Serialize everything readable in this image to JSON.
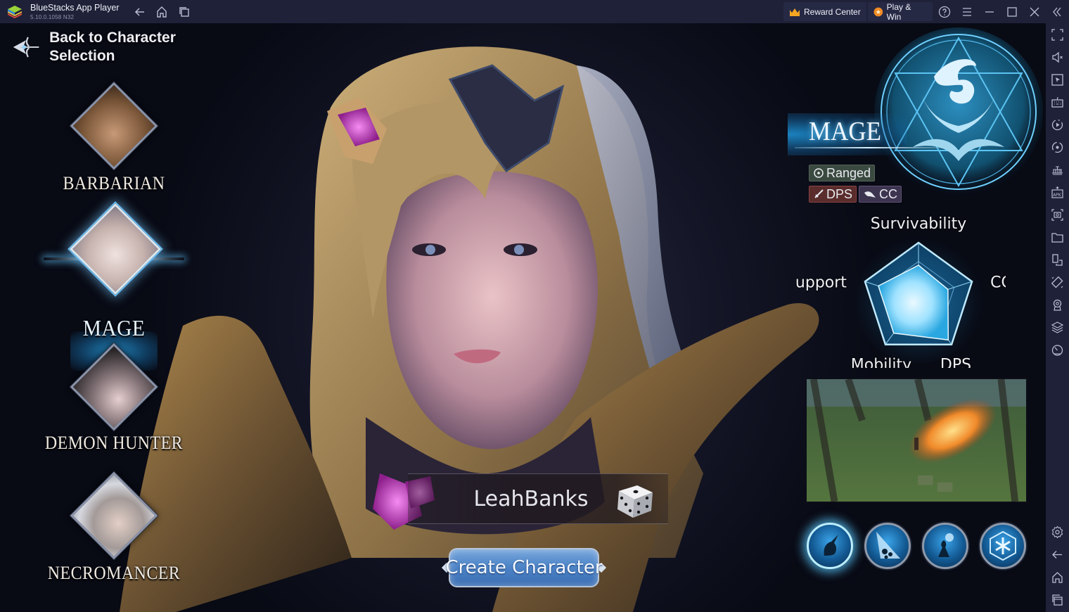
{
  "app": {
    "title": "BlueStacks App Player",
    "version": "5.10.0.1058  N32",
    "reward_center": "Reward Center",
    "play_and_win": "Play & Win",
    "nav_icons": [
      "back-arrow-icon",
      "home-icon",
      "recent-apps-icon"
    ],
    "window_controls": [
      "help-icon",
      "menu-icon",
      "minimize-icon",
      "maximize-icon",
      "close-icon",
      "collapse-sidebar-icon"
    ],
    "sidebar_icons": [
      "fullscreen-icon",
      "volume-mute-icon",
      "pointer-icon",
      "keyboard-icon",
      "macro-record-icon",
      "sync-icon",
      "build-apk-icon",
      "install-apk-icon",
      "screenshot-icon",
      "folder-icon",
      "multi-instance-icon",
      "rotate-icon",
      "location-icon",
      "layers-icon",
      "performance-icon"
    ],
    "sidebar_bottom_icons": [
      "settings-icon",
      "back-icon",
      "home-icon",
      "recent-apps-icon"
    ]
  },
  "game": {
    "back_label": "Back to Character Selection",
    "classes": [
      {
        "name": "BARBARIAN",
        "selected": false
      },
      {
        "name": "MAGE",
        "selected": true
      },
      {
        "name": "DEMON HUNTER",
        "selected": false
      },
      {
        "name": "NECROMANCER",
        "selected": false
      }
    ],
    "selected_class": {
      "title": "MAGE",
      "tags": [
        {
          "label": "Ranged",
          "icon": "crosshair-icon",
          "color": "#3b4a40"
        },
        {
          "label": "DPS",
          "icon": "sword-icon",
          "color": "#5a2c2c"
        },
        {
          "label": "CC",
          "icon": "grab-hand-icon",
          "color": "#3d3450"
        }
      ]
    },
    "skills": [
      {
        "icon": "unicorn-skill-icon",
        "selected": true
      },
      {
        "icon": "meteor-skill-icon",
        "selected": false
      },
      {
        "icon": "summon-skill-icon",
        "selected": false
      },
      {
        "icon": "frost-skill-icon",
        "selected": false
      }
    ],
    "character_name": "LeahBanks",
    "randomize_icon": "dice-icon",
    "create_button": "Create Character",
    "colors": {
      "accent": "#5fb3e8",
      "button": "#4f86c8"
    }
  },
  "chart_data": {
    "type": "radar",
    "title": "",
    "axes": [
      "Survivability",
      "CC",
      "DPS",
      "Mobility",
      "Support"
    ],
    "series": [
      {
        "name": "MAGE",
        "values": [
          0.6,
          0.55,
          0.9,
          0.75,
          0.75
        ]
      }
    ],
    "range": [
      0,
      1
    ],
    "grid_levels": 3
  }
}
